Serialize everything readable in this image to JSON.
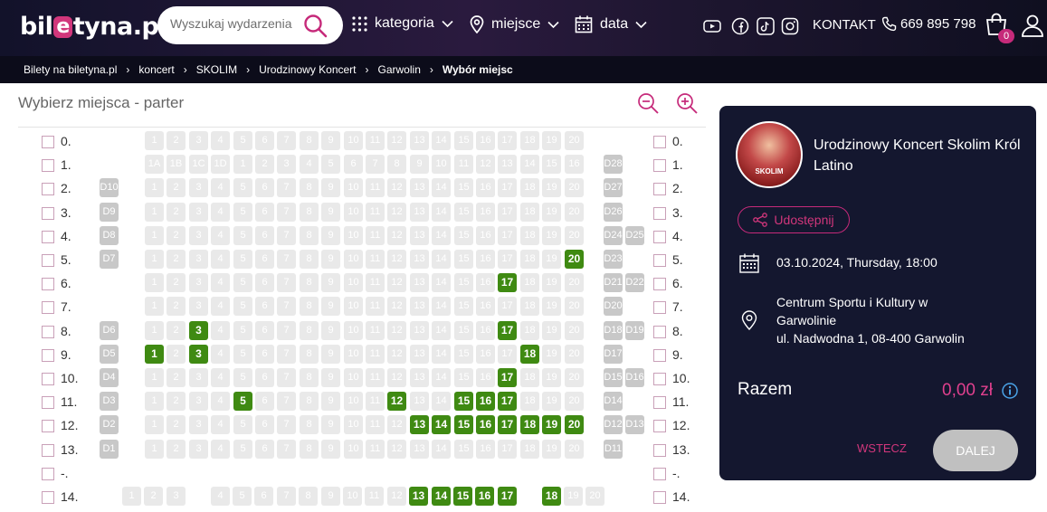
{
  "header": {
    "logo": {
      "pre": "bil",
      "mark": "e",
      "post": "tyna.pl"
    },
    "search_placeholder": "Wyszukaj wydarzenia",
    "nav": {
      "category": "kategoria",
      "place": "miejsce",
      "date": "data"
    },
    "social": [
      "youtube-icon",
      "facebook-icon",
      "tiktok-icon",
      "instagram-icon"
    ],
    "contact": "KONTAKT",
    "phone": "669 895 798",
    "cart_count": "0"
  },
  "breadcrumb": [
    "Bilety na biletyna.pl",
    "koncert",
    "SKOLIM",
    "Urodzinowy Koncert",
    "Garwolin",
    "Wybór miejsc"
  ],
  "seating": {
    "title": "Wybierz miejsca - parter",
    "rows": [
      {
        "label": "0.",
        "left": [],
        "seats": [
          "1",
          "2",
          "3",
          "4",
          "5",
          "6",
          "7",
          "8",
          "9",
          "10",
          "11",
          "12",
          "13",
          "14",
          "15",
          "16",
          "17",
          "18",
          "19",
          "20"
        ],
        "free": [],
        "right": []
      },
      {
        "label": "1.",
        "left": [],
        "seats": [
          "1A",
          "1B",
          "1C",
          "1D",
          "1",
          "2",
          "3",
          "4",
          "5",
          "6",
          "7",
          "8",
          "9",
          "10",
          "11",
          "12",
          "13",
          "14",
          "15",
          "16"
        ],
        "free": [],
        "right": [
          "D28"
        ]
      },
      {
        "label": "2.",
        "left": [
          "D10"
        ],
        "seats": [
          "1",
          "2",
          "3",
          "4",
          "5",
          "6",
          "7",
          "8",
          "9",
          "10",
          "11",
          "12",
          "13",
          "14",
          "15",
          "16",
          "17",
          "18",
          "19",
          "20"
        ],
        "free": [],
        "right": [
          "D27"
        ]
      },
      {
        "label": "3.",
        "left": [
          "D9"
        ],
        "seats": [
          "1",
          "2",
          "3",
          "4",
          "5",
          "6",
          "7",
          "8",
          "9",
          "10",
          "11",
          "12",
          "13",
          "14",
          "15",
          "16",
          "17",
          "18",
          "19",
          "20"
        ],
        "free": [],
        "right": [
          "D26"
        ]
      },
      {
        "label": "4.",
        "left": [
          "D8"
        ],
        "seats": [
          "1",
          "2",
          "3",
          "4",
          "5",
          "6",
          "7",
          "8",
          "9",
          "10",
          "11",
          "12",
          "13",
          "14",
          "15",
          "16",
          "17",
          "18",
          "19",
          "20"
        ],
        "free": [],
        "right": [
          "D24",
          "D25"
        ]
      },
      {
        "label": "5.",
        "left": [
          "D7"
        ],
        "seats": [
          "1",
          "2",
          "3",
          "4",
          "5",
          "6",
          "7",
          "8",
          "9",
          "10",
          "11",
          "12",
          "13",
          "14",
          "15",
          "16",
          "17",
          "18",
          "19",
          "20"
        ],
        "free": [
          "20"
        ],
        "right": [
          "D23"
        ]
      },
      {
        "label": "6.",
        "left": [],
        "seats": [
          "1",
          "2",
          "3",
          "4",
          "5",
          "6",
          "7",
          "8",
          "9",
          "10",
          "11",
          "12",
          "13",
          "14",
          "15",
          "16",
          "17",
          "18",
          "19",
          "20"
        ],
        "free": [
          "17"
        ],
        "right": [
          "D21",
          "D22"
        ]
      },
      {
        "label": "7.",
        "left": [],
        "seats": [
          "1",
          "2",
          "3",
          "4",
          "5",
          "6",
          "7",
          "8",
          "9",
          "10",
          "11",
          "12",
          "13",
          "14",
          "15",
          "16",
          "17",
          "18",
          "19",
          "20"
        ],
        "free": [],
        "right": [
          "D20"
        ]
      },
      {
        "label": "8.",
        "left": [
          "D6"
        ],
        "seats": [
          "1",
          "2",
          "3",
          "4",
          "5",
          "6",
          "7",
          "8",
          "9",
          "10",
          "11",
          "12",
          "13",
          "14",
          "15",
          "16",
          "17",
          "18",
          "19",
          "20"
        ],
        "free": [
          "3",
          "17"
        ],
        "right": [
          "D18",
          "D19"
        ]
      },
      {
        "label": "9.",
        "left": [
          "D5"
        ],
        "seats": [
          "1",
          "2",
          "3",
          "4",
          "5",
          "6",
          "7",
          "8",
          "9",
          "10",
          "11",
          "12",
          "13",
          "14",
          "15",
          "16",
          "17",
          "18",
          "19",
          "20"
        ],
        "free": [
          "1",
          "3",
          "18"
        ],
        "right": [
          "D17"
        ]
      },
      {
        "label": "10.",
        "left": [
          "D4"
        ],
        "seats": [
          "1",
          "2",
          "3",
          "4",
          "5",
          "6",
          "7",
          "8",
          "9",
          "10",
          "11",
          "12",
          "13",
          "14",
          "15",
          "16",
          "17",
          "18",
          "19",
          "20"
        ],
        "free": [
          "17"
        ],
        "right": [
          "D15",
          "D16"
        ]
      },
      {
        "label": "11.",
        "left": [
          "D3"
        ],
        "seats": [
          "1",
          "2",
          "3",
          "4",
          "5",
          "6",
          "7",
          "8",
          "9",
          "10",
          "11",
          "12",
          "13",
          "14",
          "15",
          "16",
          "17",
          "18",
          "19",
          "20"
        ],
        "free": [
          "5",
          "12",
          "15",
          "16",
          "17"
        ],
        "right": [
          "D14"
        ]
      },
      {
        "label": "12.",
        "left": [
          "D2"
        ],
        "seats": [
          "1",
          "2",
          "3",
          "4",
          "5",
          "6",
          "7",
          "8",
          "9",
          "10",
          "11",
          "12",
          "13",
          "14",
          "15",
          "16",
          "17",
          "18",
          "19",
          "20"
        ],
        "free": [
          "13",
          "14",
          "15",
          "16",
          "17",
          "18",
          "19",
          "20"
        ],
        "right": [
          "D12",
          "D13"
        ]
      },
      {
        "label": "13.",
        "left": [
          "D1"
        ],
        "seats": [
          "1",
          "2",
          "3",
          "4",
          "5",
          "6",
          "7",
          "8",
          "9",
          "10",
          "11",
          "12",
          "13",
          "14",
          "15",
          "16",
          "17",
          "18",
          "19",
          "20"
        ],
        "free": [],
        "right": [
          "D11"
        ]
      },
      {
        "label": "-.",
        "left": [],
        "seats": [],
        "free": [],
        "right": []
      },
      {
        "label": "14.",
        "left": [],
        "seats": [
          "1",
          "2",
          "3",
          "",
          "4",
          "5",
          "6",
          "7",
          "8",
          "9",
          "10",
          "11",
          "12",
          "13",
          "14",
          "15",
          "16",
          "17",
          "",
          "18",
          "19",
          "20"
        ],
        "free": [
          "13",
          "14",
          "15",
          "16",
          "17",
          "18"
        ],
        "right": []
      }
    ]
  },
  "event": {
    "avatar_caption": "SKOLIM",
    "title": "Urodzinowy Koncert Skolim Król Latino",
    "share": "Udostępnij",
    "datetime": "03.10.2024, Thursday, 18:00",
    "venue_name": "Centrum Sportu i Kultury w Garwolinie",
    "venue_address": "ul. Nadwodna 1, 08-400 Garwolin",
    "total_label": "Razem",
    "total_value": "0,00 zł",
    "back": "WSTECZ",
    "next": "DALEJ"
  },
  "colors": {
    "accent": "#c62a7a",
    "seat_free": "#3f8a12",
    "seat_taken": "#e9e9e9",
    "card_bg": "#14172f"
  }
}
